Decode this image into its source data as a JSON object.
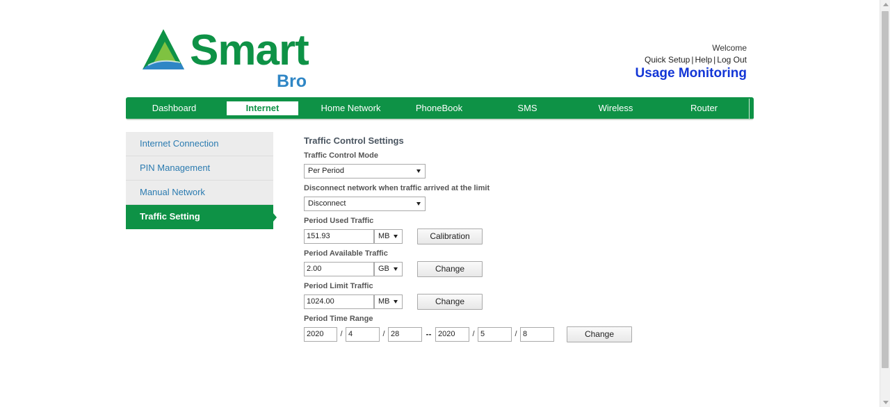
{
  "brand": {
    "name": "Smart",
    "sub": "Bro",
    "primary_color": "#0e9246",
    "secondary_color": "#2f86c5",
    "icon": "smart-triangle-logo-icon"
  },
  "header": {
    "welcome": "Welcome",
    "links": [
      "Quick Setup",
      "Help",
      "Log Out"
    ],
    "page_title": "Usage Monitoring"
  },
  "nav": {
    "items": [
      "Dashboard",
      "Internet",
      "Home Network",
      "PhoneBook",
      "SMS",
      "Wireless",
      "Router"
    ],
    "active": "Internet"
  },
  "sidebar": {
    "items": [
      "Internet Connection",
      "PIN Management",
      "Manual Network",
      "Traffic Setting"
    ],
    "active": "Traffic Setting"
  },
  "form": {
    "section_title": "Traffic Control Settings",
    "mode": {
      "label": "Traffic Control Mode",
      "value": "Per Period"
    },
    "disconnect": {
      "label": "Disconnect network when traffic arrived at the limit",
      "value": "Disconnect"
    },
    "used": {
      "label": "Period Used Traffic",
      "value": "151.93",
      "unit": "MB",
      "button": "Calibration"
    },
    "available": {
      "label": "Period Available Traffic",
      "value": "2.00",
      "unit": "GB",
      "button": "Change"
    },
    "limit": {
      "label": "Period Limit Traffic",
      "value": "1024.00",
      "unit": "MB",
      "button": "Change"
    },
    "time_range": {
      "label": "Period Time Range",
      "start": {
        "year": "2020",
        "month": "4",
        "day": "28"
      },
      "end": {
        "year": "2020",
        "month": "5",
        "day": "8"
      },
      "date_separator": "/",
      "range_separator": "--",
      "button": "Change"
    }
  }
}
